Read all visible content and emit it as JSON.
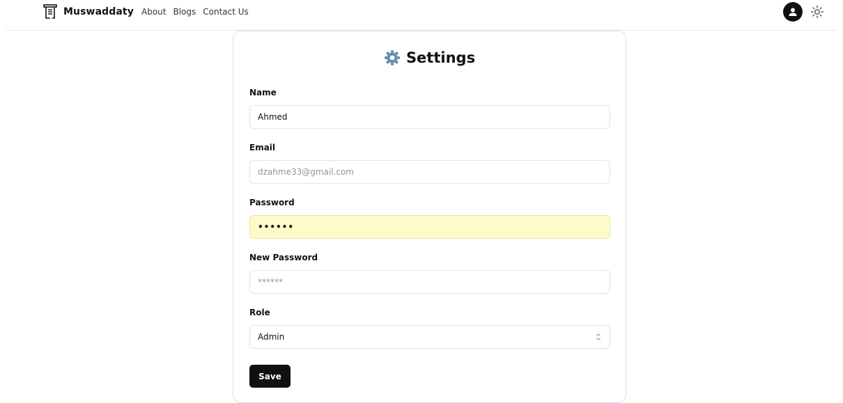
{
  "nav": {
    "brand": "Muswaddaty",
    "links": [
      {
        "label": "About"
      },
      {
        "label": "Blogs"
      },
      {
        "label": "Contact Us"
      }
    ]
  },
  "settings": {
    "title": "Settings",
    "fields": {
      "name": {
        "label": "Name",
        "value": "Ahmed"
      },
      "email": {
        "label": "Email",
        "placeholder": "dzahme33@gmail.com"
      },
      "password": {
        "label": "Password",
        "value": "••••••"
      },
      "new_password": {
        "label": "New Password",
        "placeholder": "******"
      },
      "role": {
        "label": "Role",
        "selected": "Admin"
      }
    },
    "save_label": "Save"
  },
  "colors": {
    "primary": "#111111",
    "autofill_bg": "#fefac9",
    "border": "#e1e4e8"
  },
  "icons": [
    "document-icon",
    "user-avatar-icon",
    "sun-icon",
    "gear-icon",
    "chevron-up-down-icon"
  ]
}
